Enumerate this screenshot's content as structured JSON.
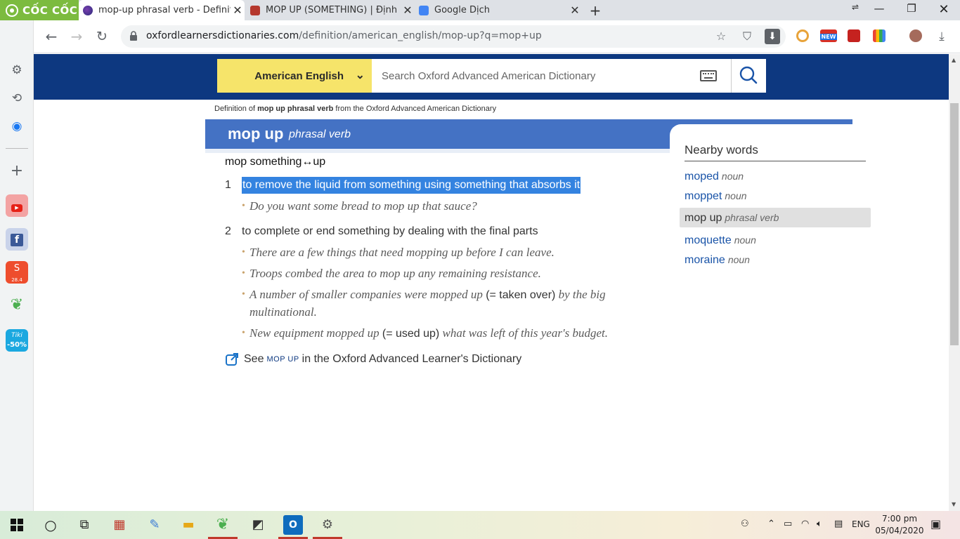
{
  "browser": {
    "brand": "CỐC CỐC",
    "tabs": [
      {
        "title": "mop-up phrasal verb - Definiti",
        "active": true
      },
      {
        "title": "MOP UP (SOMETHING) | Định",
        "active": false
      },
      {
        "title": "Google Dịch",
        "active": false
      }
    ],
    "url_host": "oxfordlearnersdictionaries.com",
    "url_path": "/definition/american_english/mop-up?q=mop+up",
    "ext_new_label": "NEW"
  },
  "sidebar": {
    "shopee_badge": "28.4",
    "tiki_label": "Tiki",
    "tiki_discount": "-50%"
  },
  "site": {
    "dictionary_select": "American English",
    "search_placeholder": "Search Oxford Advanced American Dictionary",
    "breadcrumb_prefix": "Definition of ",
    "breadcrumb_term": "mop up phrasal verb",
    "breadcrumb_suffix": " from the Oxford Advanced American Dictionary"
  },
  "entry": {
    "headword": "mop up",
    "pos": "phrasal verb",
    "idiom": "mop something↔up",
    "senses": [
      {
        "num": "1",
        "def": "to remove the liquid from something using something that absorbs it",
        "examples": [
          {
            "text": "Do you want some bread to mop up that sauce?"
          }
        ]
      },
      {
        "num": "2",
        "def": "to complete or end something by dealing with the final parts",
        "examples": [
          {
            "text": "There are a few things that need mopping up before I can leave."
          },
          {
            "text": "Troops combed the area to mop up any remaining resistance."
          },
          {
            "pre": "A number of smaller companies were mopped up ",
            "gloss": "(= taken over)",
            "post": " by the big multinational."
          },
          {
            "pre": "New equipment mopped up ",
            "gloss": "(= used up)",
            "post": " what was left of this year's budget."
          }
        ]
      }
    ],
    "see_also": {
      "pre": "See",
      "term": "MOP UP",
      "post": "in the Oxford Advanced Learner's Dictionary"
    }
  },
  "nearby": {
    "title": "Nearby words",
    "items": [
      {
        "word": "moped",
        "pos": "noun"
      },
      {
        "word": "moppet",
        "pos": "noun"
      },
      {
        "word": "mop up",
        "pos": "phrasal verb",
        "current": true
      },
      {
        "word": "moquette",
        "pos": "noun"
      },
      {
        "word": "moraine",
        "pos": "noun"
      }
    ]
  },
  "taskbar": {
    "lang": "ENG",
    "time": "7:00 pm",
    "date": "05/04/2020"
  },
  "colors": {
    "banner": "#0d3880",
    "headbar": "#4472c4",
    "dict_select": "#f6e46a",
    "selection": "#3483e0",
    "link": "#1a54a8"
  }
}
